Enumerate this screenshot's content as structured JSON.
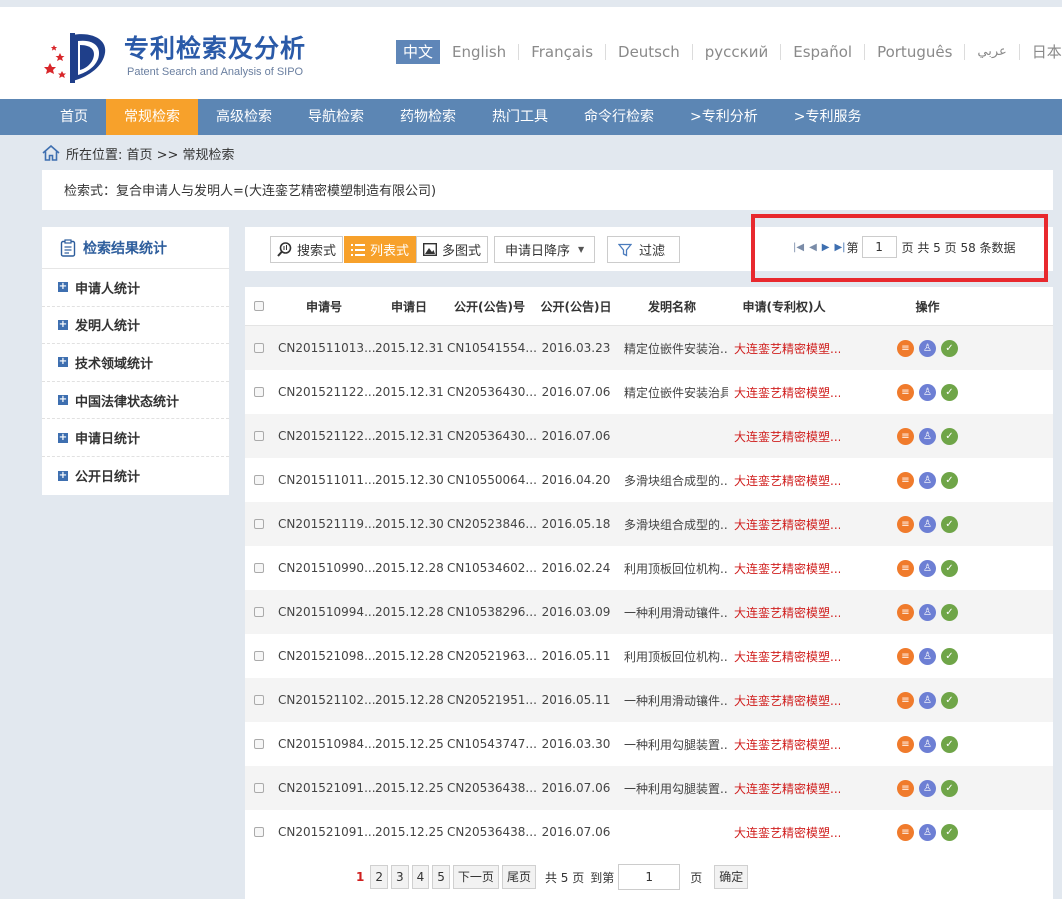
{
  "header": {
    "title_cn": "专利检索及分析",
    "title_en": "Patent Search and Analysis of SIPO",
    "languages": [
      "中文",
      "English",
      "Français",
      "Deutsch",
      "русский",
      "Español",
      "Português",
      "عربي",
      "日本語"
    ]
  },
  "nav": [
    "首页",
    "常规检索",
    "高级检索",
    "导航检索",
    "药物检索",
    "热门工具",
    "命令行检索",
    ">专利分析",
    ">专利服务"
  ],
  "breadcrumb": "所在位置: 首页 >> 常规检索",
  "query": "检索式：复合申请人与发明人=(大连銮艺精密模塑制造有限公司)",
  "stats": {
    "title": "检索结果统计",
    "items": [
      "申请人统计",
      "发明人统计",
      "技术领域统计",
      "中国法律状态统计",
      "申请日统计",
      "公开日统计"
    ]
  },
  "toolbar": {
    "search_mode": "搜索式",
    "list_mode": "列表式",
    "multi_mode": "多图式",
    "sort": "申请日降序",
    "filter": "过滤"
  },
  "pager_top": {
    "prefix": "第",
    "page": "1",
    "summary": "页 共 5 页 58 条数据"
  },
  "table": {
    "headers": [
      "申请号",
      "申请日",
      "公开(公告)号",
      "公开(公告)日",
      "发明名称",
      "申请(专利权)人",
      "操作"
    ],
    "rows": [
      {
        "no": "CN201511013...",
        "date": "2015.12.31",
        "pub": "CN10541554...",
        "pdate": "2016.03.23",
        "title": "精定位嵌件安装治...",
        "app": "大连銮艺精密模塑..."
      },
      {
        "no": "CN201521122...",
        "date": "2015.12.31",
        "pub": "CN20536430...",
        "pdate": "2016.07.06",
        "title": "精定位嵌件安装治具",
        "app": "大连銮艺精密模塑..."
      },
      {
        "no": "CN201521122...",
        "date": "2015.12.31",
        "pub": "CN20536430...",
        "pdate": "2016.07.06",
        "title": "",
        "app": "大连銮艺精密模塑..."
      },
      {
        "no": "CN201511011...",
        "date": "2015.12.30",
        "pub": "CN10550064...",
        "pdate": "2016.04.20",
        "title": "多滑块组合成型的...",
        "app": "大连銮艺精密模塑..."
      },
      {
        "no": "CN201521119...",
        "date": "2015.12.30",
        "pub": "CN20523846...",
        "pdate": "2016.05.18",
        "title": "多滑块组合成型的...",
        "app": "大连銮艺精密模塑..."
      },
      {
        "no": "CN201510990...",
        "date": "2015.12.28",
        "pub": "CN10534602...",
        "pdate": "2016.02.24",
        "title": "利用顶板回位机构...",
        "app": "大连銮艺精密模塑..."
      },
      {
        "no": "CN201510994...",
        "date": "2015.12.28",
        "pub": "CN10538296...",
        "pdate": "2016.03.09",
        "title": "一种利用滑动镶件...",
        "app": "大连銮艺精密模塑..."
      },
      {
        "no": "CN201521098...",
        "date": "2015.12.28",
        "pub": "CN20521963...",
        "pdate": "2016.05.11",
        "title": "利用顶板回位机构...",
        "app": "大连銮艺精密模塑..."
      },
      {
        "no": "CN201521102...",
        "date": "2015.12.28",
        "pub": "CN20521951...",
        "pdate": "2016.05.11",
        "title": "一种利用滑动镶件...",
        "app": "大连銮艺精密模塑..."
      },
      {
        "no": "CN201510984...",
        "date": "2015.12.25",
        "pub": "CN10543747...",
        "pdate": "2016.03.30",
        "title": "一种利用勾腿装置...",
        "app": "大连銮艺精密模塑..."
      },
      {
        "no": "CN201521091...",
        "date": "2015.12.25",
        "pub": "CN20536438...",
        "pdate": "2016.07.06",
        "title": "一种利用勾腿装置...",
        "app": "大连銮艺精密模塑..."
      },
      {
        "no": "CN201521091...",
        "date": "2015.12.25",
        "pub": "CN20536438...",
        "pdate": "2016.07.06",
        "title": "",
        "app": "大连銮艺精密模塑..."
      }
    ]
  },
  "pager_bottom": {
    "current": "1",
    "pages": [
      "2",
      "3",
      "4",
      "5"
    ],
    "next": "下一页",
    "last": "尾页",
    "total": "共 5 页",
    "goto": "到第",
    "goto_value": "1",
    "page_unit": "页",
    "confirm": "确定"
  },
  "colors": {
    "accent": "#f7a12b",
    "nav": "#5c86b4",
    "brand": "#2a5aa8",
    "applicant": "#d0201f",
    "highlight": "#e8292e"
  }
}
